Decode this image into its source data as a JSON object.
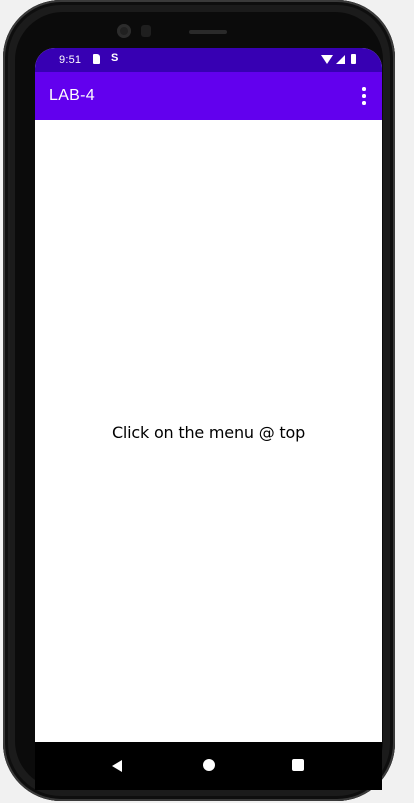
{
  "status_bar": {
    "time": "9:51",
    "icons": [
      "sd-card-icon",
      "s-icon",
      "wifi-icon",
      "signal-icon",
      "battery-icon"
    ],
    "s_glyph": "S"
  },
  "app_bar": {
    "title": "LAB-4",
    "menu_icon": "overflow-menu-icon",
    "color": "#6200ee"
  },
  "status_bar_color": "#3700b3",
  "content": {
    "message": "Click on the menu @ top"
  },
  "nav_bar": {
    "buttons": [
      "back-icon",
      "home-icon",
      "recents-icon"
    ]
  },
  "device": {
    "power_button_color": "#e2725b"
  }
}
